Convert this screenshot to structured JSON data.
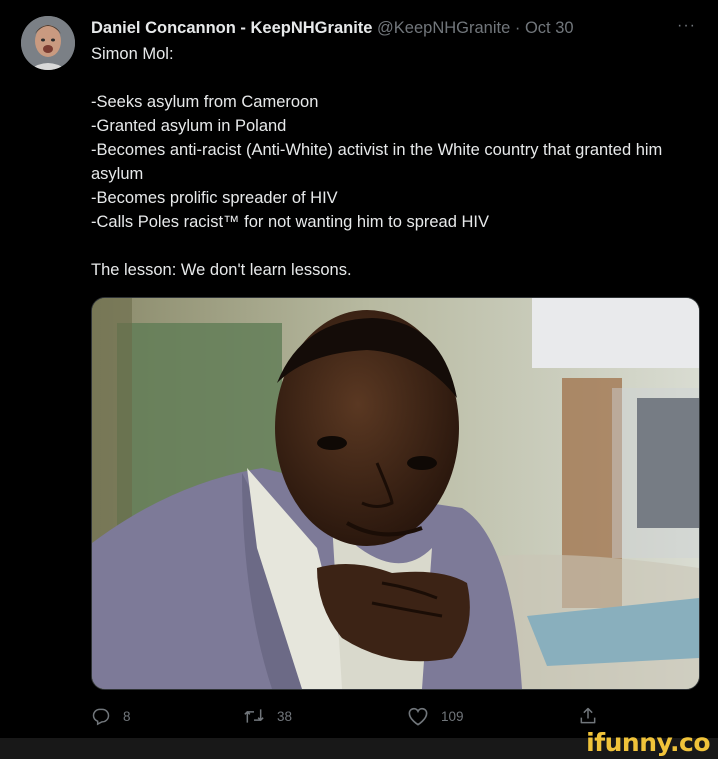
{
  "tweet": {
    "author": {
      "display_name": "Daniel Concannon - KeepNHGranite",
      "handle": "@KeepNHGranite",
      "separator": "·",
      "date": "Oct 30"
    },
    "more_label": "···",
    "body_lines": [
      "Simon Mol:",
      "",
      "-Seeks asylum from Cameroon",
      "-Granted asylum in Poland",
      "-Becomes anti-racist (Anti-White) activist in the White country that granted him asylum",
      "-Becomes prolific spreader of HIV",
      "-Calls Poles racist™ for not wanting him to spread HIV",
      "",
      "The lesson: We don't learn lessons."
    ],
    "actions": {
      "reply_count": "8",
      "retweet_count": "38",
      "like_count": "109"
    }
  },
  "watermark": "ifunny.co",
  "icons": {
    "reply": "reply-icon",
    "retweet": "retweet-icon",
    "like": "heart-icon",
    "share": "share-icon"
  },
  "colors": {
    "background": "#000000",
    "text": "#e7e9ea",
    "muted": "#71767b",
    "watermark": "#f0c33a"
  }
}
